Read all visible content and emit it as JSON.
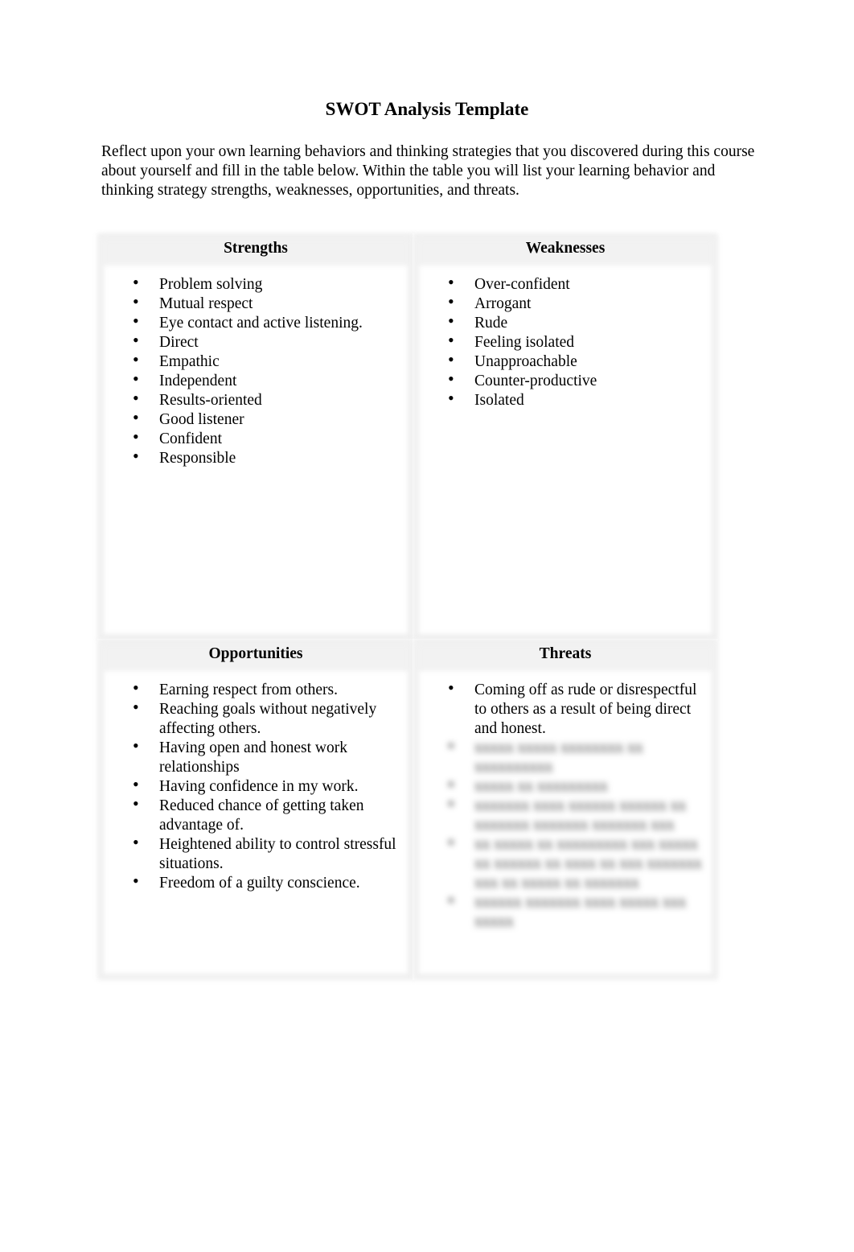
{
  "document": {
    "title": "SWOT Analysis Template",
    "intro": "Reflect upon your own learning behaviors and thinking strategies that you discovered during this course about yourself and fill in the table below. Within the table you will list your learning behavior and thinking strategy strengths, weaknesses, opportunities, and threats."
  },
  "swot": {
    "strengths": {
      "heading": "Strengths",
      "items": [
        "Problem solving",
        "Mutual respect",
        "Eye contact and active listening.",
        "Direct",
        "Empathic",
        "Independent",
        "Results-oriented",
        "Good listener",
        "Confident",
        "Responsible"
      ]
    },
    "weaknesses": {
      "heading": "Weaknesses",
      "items": [
        "Over-confident",
        "Arrogant",
        "Rude",
        "Feeling isolated",
        "Unapproachable",
        "Counter-productive",
        "Isolated"
      ]
    },
    "opportunities": {
      "heading": "Opportunities",
      "items": [
        "Earning respect from others.",
        "Reaching goals without negatively affecting others.",
        "Having open and honest work relationships",
        "Having confidence in my work.",
        "Reduced chance of getting taken advantage of.",
        "Heightened ability to control stressful situations.",
        "Freedom of a guilty conscience."
      ]
    },
    "threats": {
      "heading": "Threats",
      "items": [
        "Coming off as rude or disrespectful to others as a result of being direct and honest."
      ],
      "blurred_items": [
        "xxxxx xxxxx xxxxxxxx xx xxxxxxxxxx",
        "xxxxx xx xxxxxxxxx",
        "xxxxxxx xxxx xxxxxx xxxxxx xx xxxxxxx xxxxxxx xxxxxxx xxx",
        "xx xxxxx xx xxxxxxxxx xxx xxxxx xx xxxxxx xx xxxx xx xxx xxxxxxx xxx xx xxxxx xx xxxxxxx",
        "xxxxxx xxxxxxx xxxx xxxxx xxx xxxxx"
      ]
    }
  }
}
